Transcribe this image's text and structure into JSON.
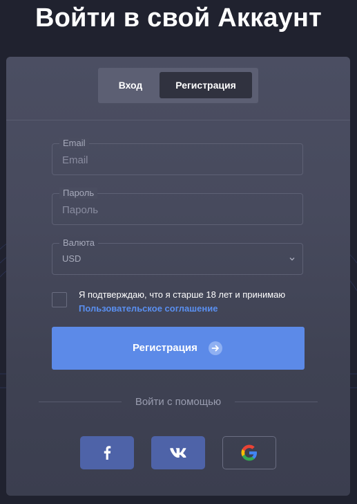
{
  "page": {
    "title": "Войти в свой Аккаунт"
  },
  "tabs": [
    {
      "label": "Вход",
      "active": false
    },
    {
      "label": "Регистрация",
      "active": true
    }
  ],
  "form": {
    "email": {
      "label": "Email",
      "placeholder": "Email",
      "value": ""
    },
    "password": {
      "label": "Пароль",
      "placeholder": "Пароль",
      "value": ""
    },
    "currency": {
      "label": "Валюта",
      "selected": "USD"
    },
    "consent": {
      "text": "Я подтверждаю, что я старше 18 лет и принимаю",
      "link": "Пользовательское соглашение",
      "checked": false
    },
    "submit_label": "Регистрация"
  },
  "social": {
    "title": "Войти с помощью",
    "buttons": [
      {
        "icon": "facebook-icon"
      },
      {
        "icon": "vk-icon"
      },
      {
        "icon": "google-icon"
      }
    ]
  },
  "colors": {
    "background": "#20222f",
    "card": "#474a5d",
    "accent": "#5c8ae8",
    "link": "#5a8ff0",
    "social": "#4e63a8"
  }
}
